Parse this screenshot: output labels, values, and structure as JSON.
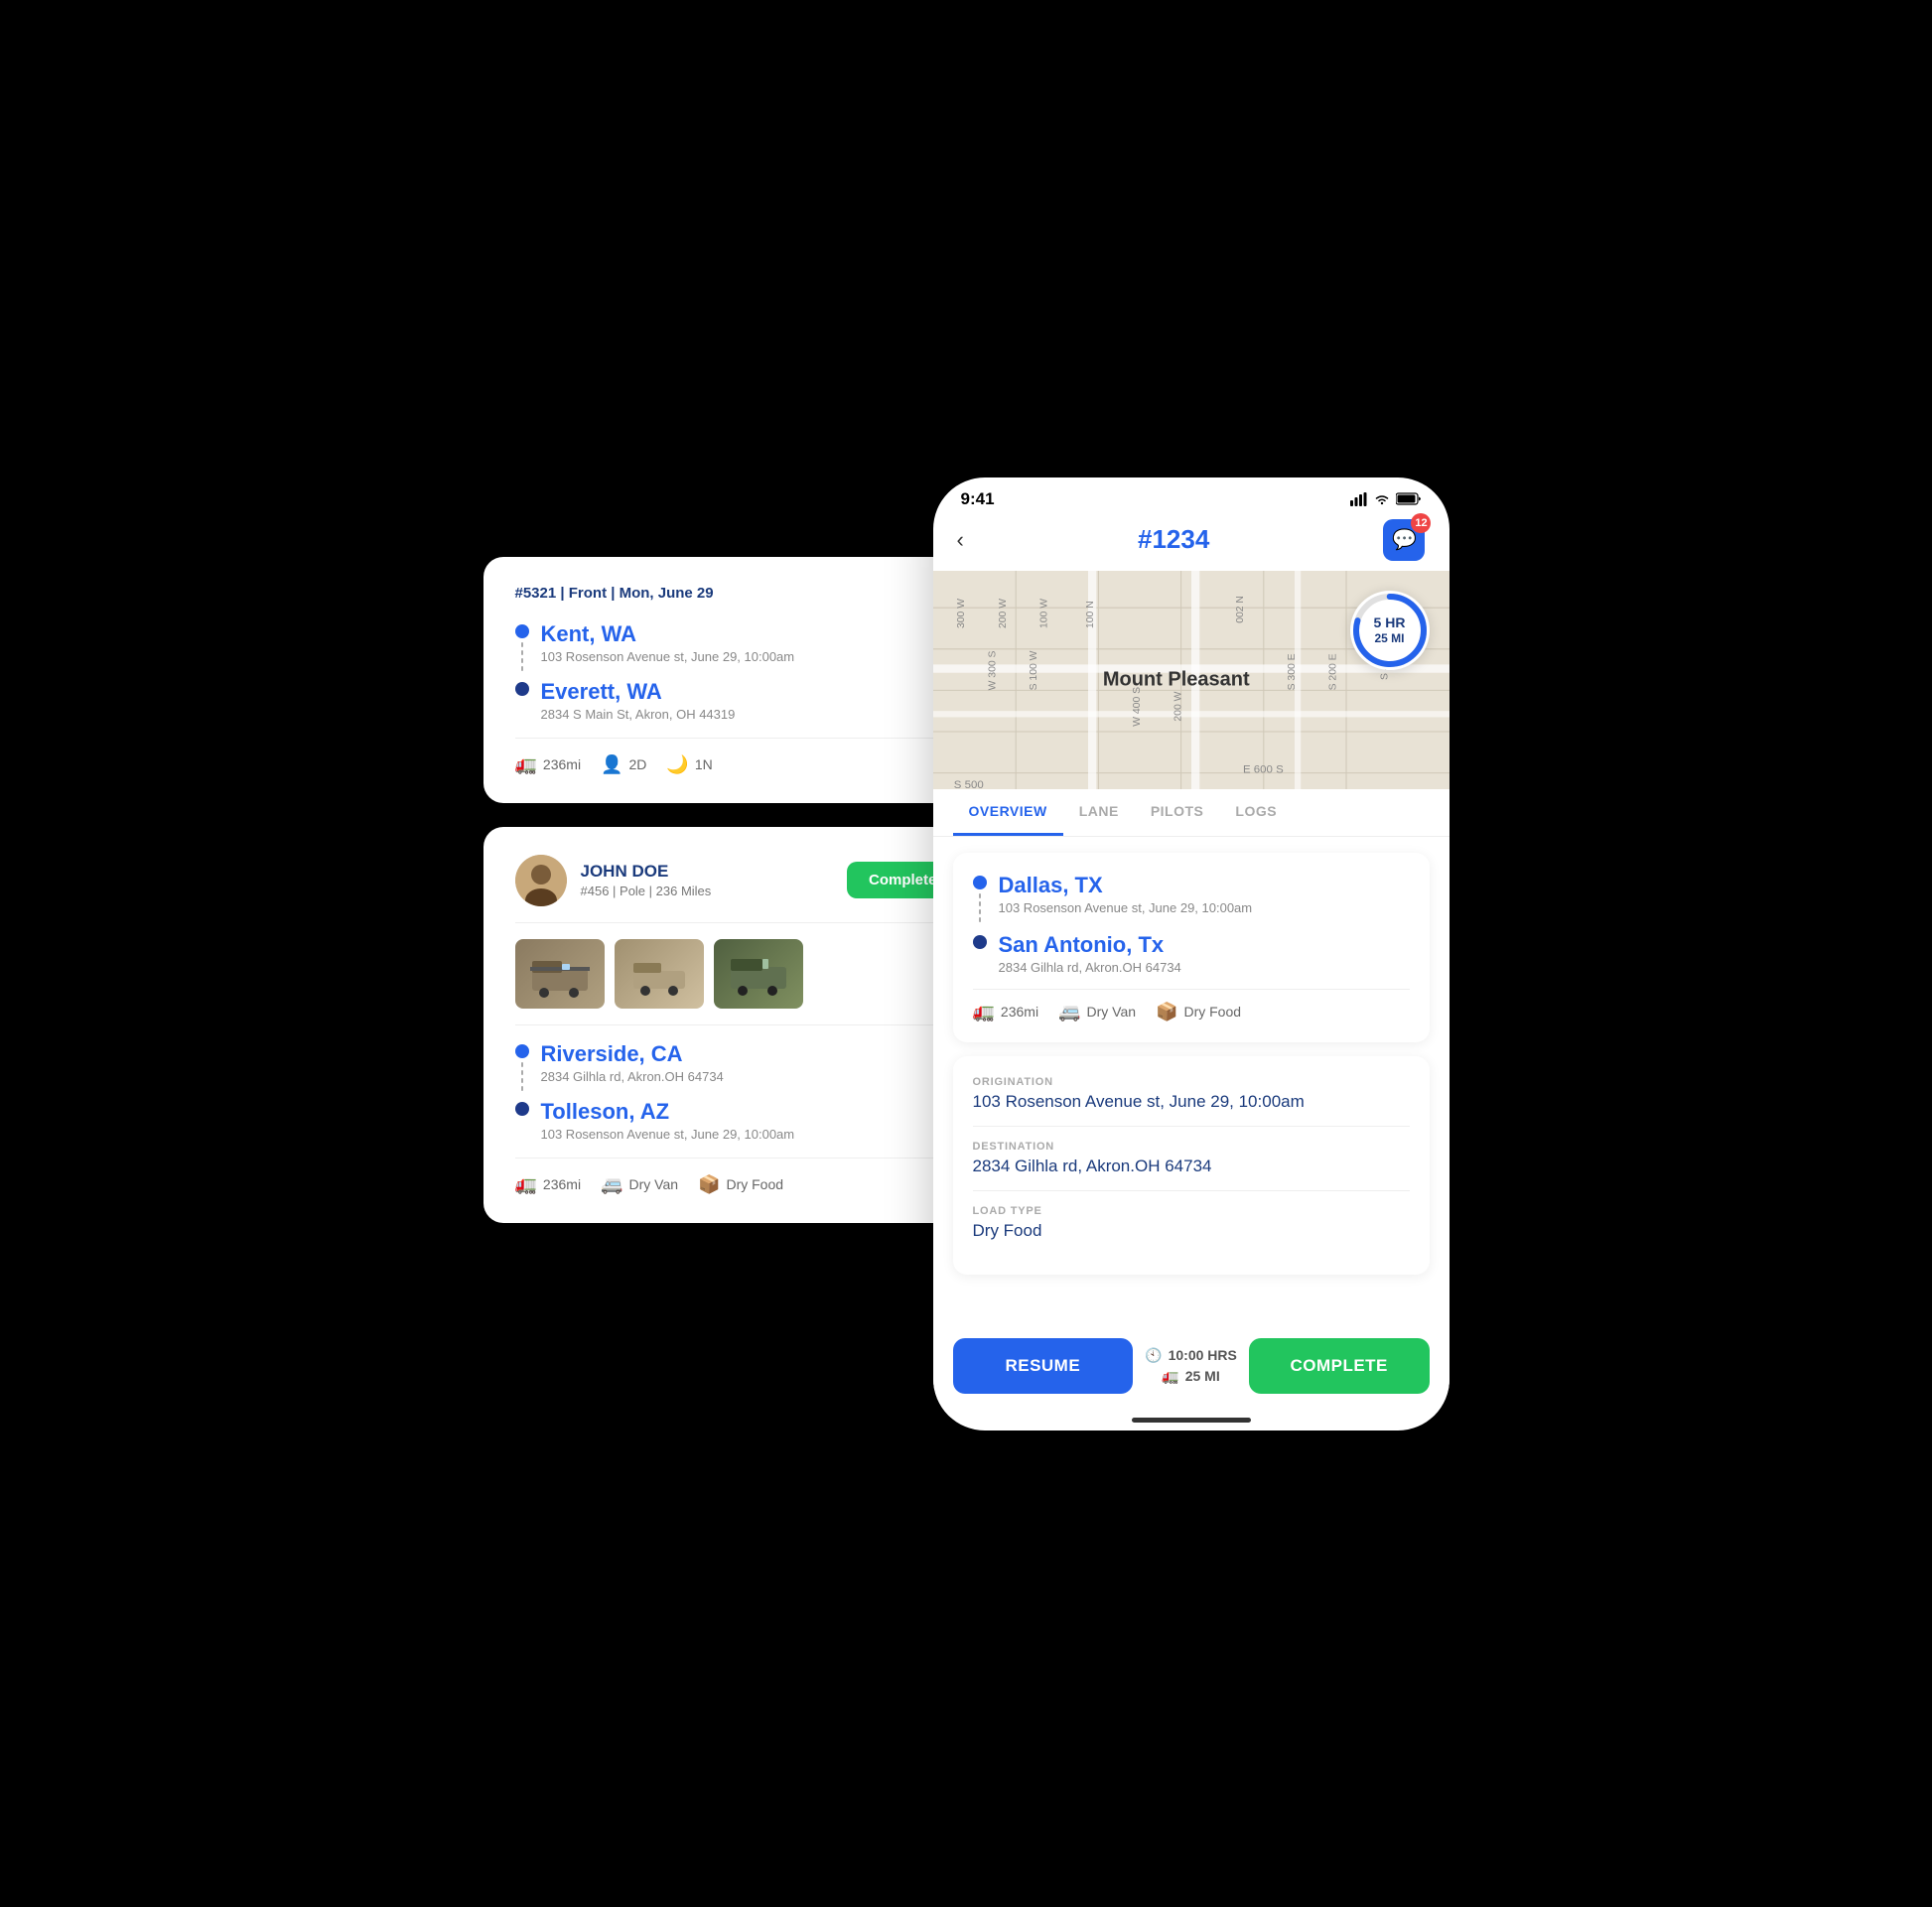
{
  "card1": {
    "header": "#5321 | Front | Mon, June 29",
    "origin_city": "Kent, WA",
    "origin_address": "103 Rosenson Avenue st, June 29, 10:00am",
    "dest_city": "Everett, WA",
    "dest_address": "2834 S Main St, Akron, OH 44319",
    "miles": "236mi",
    "drivers": "2D",
    "nights": "1N"
  },
  "card2": {
    "user_name": "JOHN DOE",
    "user_sub": "#456  |  Pole  |  236 Miles",
    "status": "Completed",
    "origin_city": "Riverside, CA",
    "origin_address": "2834 Gilhla rd, Akron.OH 64734",
    "dest_city": "Tolleson, AZ",
    "dest_address": "103 Rosenson Avenue st, June 29, 10:00am",
    "miles": "236mi",
    "van_type": "Dry Van",
    "load_type": "Dry Food"
  },
  "phone": {
    "status_time": "9:41",
    "order_id": "#1234",
    "msg_count": "12",
    "map_city": "Mount Pleasant",
    "map_hours": "5 HR",
    "map_miles": "25 MI",
    "tabs": [
      "OVERVIEW",
      "LANE",
      "PILOTS",
      "LOGS"
    ],
    "active_tab": "OVERVIEW",
    "route_city1": "Dallas, TX",
    "route_addr1": "103 Rosenson Avenue st, June 29, 10:00am",
    "route_city2": "San Antonio, Tx",
    "route_addr2": "2834 Gilhla rd, Akron.OH 64734",
    "route_miles": "236mi",
    "route_van": "Dry Van",
    "route_load": "Dry Food",
    "origin_label": "ORIGINATION",
    "origin_value": "103 Rosenson Avenue st, June 29, 10:00am",
    "dest_label": "DESTINATION",
    "dest_value": "2834 Gilhla rd, Akron.OH 64734",
    "load_label": "LOAD TYPE",
    "load_value": "Dry Food",
    "btn_resume": "RESUME",
    "btn_time": "10:00 HRS",
    "btn_miles": "25 MI",
    "btn_complete": "COMPLETE"
  }
}
